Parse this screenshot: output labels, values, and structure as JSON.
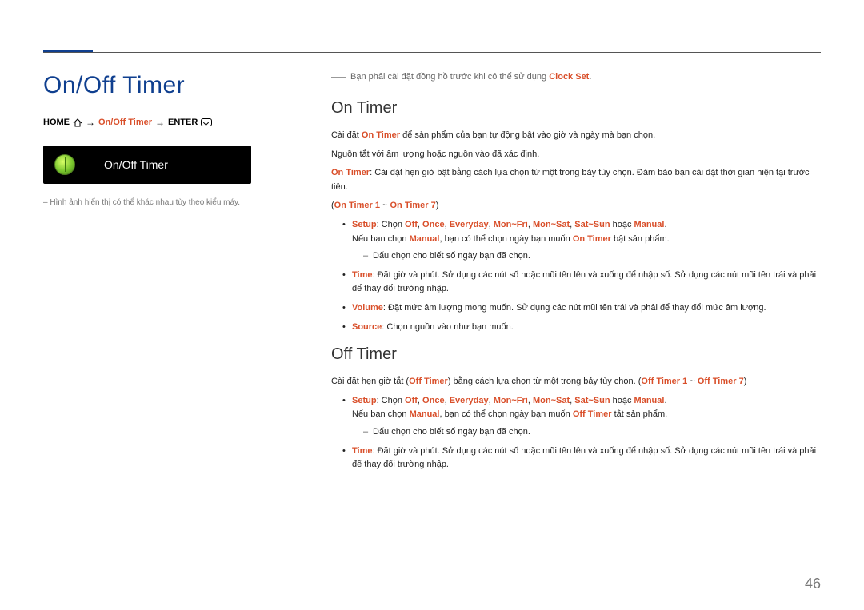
{
  "page": {
    "title": "On/Off Timer",
    "breadcrumb": {
      "home": "HOME",
      "middle": "On/Off Timer",
      "enter": "ENTER"
    },
    "menu_box_label": "On/Off Timer",
    "footnote": "– Hình ảnh hiển thị có thể khác nhau tùy theo kiểu máy.",
    "page_number": "46"
  },
  "right": {
    "prenote_prefix": "Bạn phải cài đặt đồng hồ trước khi có thể sử dụng ",
    "prenote_hl": "Clock Set",
    "prenote_suffix": ".",
    "on_timer": {
      "heading": "On Timer",
      "p1_a": "Cài đặt ",
      "p1_hl": "On Timer",
      "p1_b": " để sản phẩm của bạn tự động bật vào giờ và ngày mà bạn chọn.",
      "p2": "Nguồn tắt với âm lượng hoặc nguồn vào đã xác định.",
      "p3_hl": "On Timer",
      "p3_b": ": Cài đặt hẹn giờ bật bằng cách lựa chọn từ một trong bảy tùy chọn. Đảm bảo bạn cài đặt thời gian hiện tại trước tiên.",
      "range_open": "(",
      "range_a": "On Timer 1",
      "range_mid": " ~ ",
      "range_b": "On Timer 7",
      "range_close": ")",
      "setup_label": "Setup",
      "setup_text_a": ": Chọn ",
      "setup_opts": {
        "off": "Off",
        "once": "Once",
        "everyday": "Everyday",
        "monfri": "Mon~Fri",
        "monsat": "Mon~Sat",
        "satsun": "Sat~Sun"
      },
      "setup_or": " hoặc ",
      "setup_manual": "Manual",
      "setup_tail": ".",
      "setup_sentence2_a": "Nếu bạn chọn ",
      "setup_sentence2_b": ", bạn có thể chọn ngày bạn muốn ",
      "setup_sentence2_c": " bật sản phẩm.",
      "setup_sub": "Dấu chọn cho biết số ngày bạn đã chọn.",
      "time_label": "Time",
      "time_text": ": Đặt giờ và phút. Sử dụng các nút số hoặc mũi tên lên và xuống để nhập số. Sử dụng các nút mũi tên trái và phải để thay đổi trường nhập.",
      "volume_label": "Volume",
      "volume_text": ": Đặt mức âm lượng mong muốn. Sử dụng các nút mũi tên trái và phải để thay đổi mức âm lượng.",
      "source_label": "Source",
      "source_text": ": Chọn nguồn vào như bạn muốn."
    },
    "off_timer": {
      "heading": "Off Timer",
      "p1_a": "Cài đặt hẹn giờ tắt (",
      "p1_hl": "Off Timer",
      "p1_b": ") bằng cách lựa chọn từ một trong bảy tùy chọn. (",
      "range_a": "Off Timer 1",
      "range_mid": " ~ ",
      "range_b": "Off Timer 7",
      "range_close": ")",
      "setup_label": "Setup",
      "setup_text_a": ": Chọn ",
      "setup_or": " hoặc ",
      "setup_manual": "Manual",
      "setup_tail": ".",
      "setup_sentence2_a": "Nếu bạn chọn ",
      "setup_sentence2_b": ", bạn có thể chọn ngày bạn muốn ",
      "setup_sentence2_c": " tắt sản phẩm.",
      "setup_sub": "Dấu chọn cho biết số ngày bạn đã chọn.",
      "time_label": "Time",
      "time_text": ": Đặt giờ và phút. Sử dụng các nút số hoặc mũi tên lên và xuống để nhập số. Sử dụng các nút mũi tên trái và phải để thay đổi trường nhập."
    }
  }
}
